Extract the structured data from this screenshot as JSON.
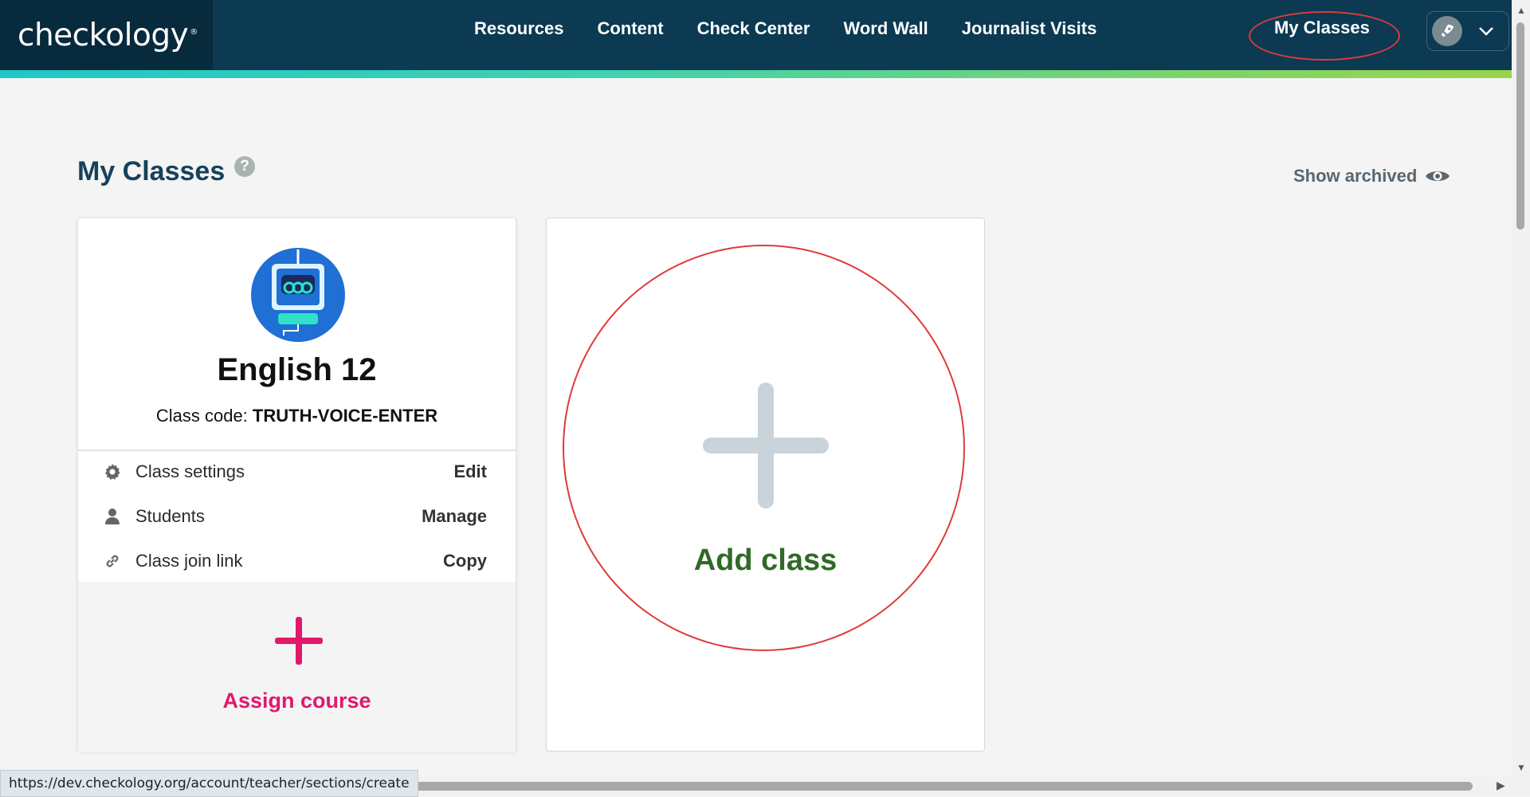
{
  "header": {
    "logo": "checkology",
    "logo_mark": "®",
    "nav": [
      "Resources",
      "Content",
      "Check Center",
      "Word Wall",
      "Journalist Visits"
    ],
    "my_classes": "My Classes"
  },
  "page": {
    "title": "My Classes",
    "help": "?",
    "show_archived": "Show archived"
  },
  "class_card": {
    "name": "English 12",
    "code_label": "Class code:",
    "code_value": "TRUTH-VOICE-ENTER",
    "rows": [
      {
        "icon": "gear-icon",
        "label": "Class settings",
        "action": "Edit"
      },
      {
        "icon": "user-icon",
        "label": "Students",
        "action": "Manage"
      },
      {
        "icon": "link-icon",
        "label": "Class join link",
        "action": "Copy"
      }
    ],
    "assign_label": "Assign course"
  },
  "add_card": {
    "label": "Add class"
  },
  "status": {
    "url": "https://dev.checkology.org/account/teacher/sections/create"
  },
  "colors": {
    "header_bg": "#0b3a52",
    "assign_pink": "#e0196a",
    "add_green": "#2f6a26",
    "highlight_red": "#e03a3a"
  }
}
